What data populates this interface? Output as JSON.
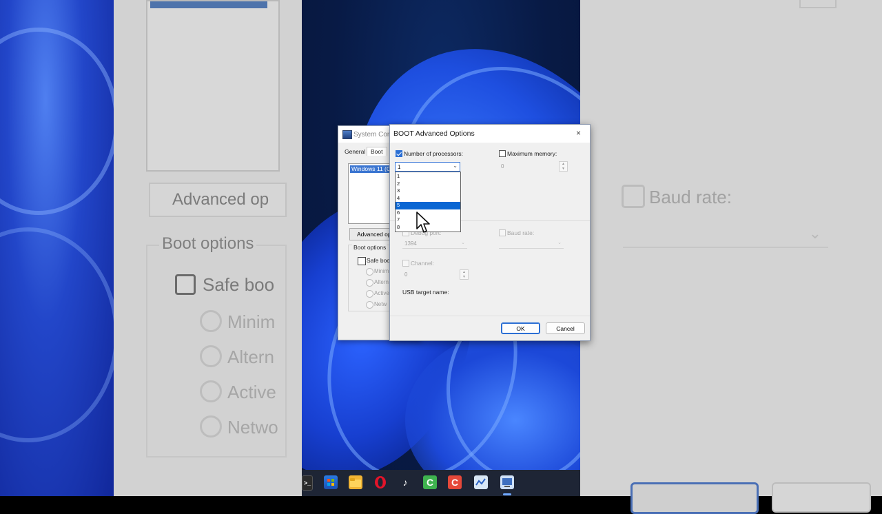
{
  "background_left": {
    "advanced_button": "Advanced op",
    "boot_options_title": "Boot options",
    "safe_boot_label": "Safe boo",
    "radios": [
      "Minim",
      "Altern",
      "Active",
      "Netwo"
    ]
  },
  "background_right": {
    "baud_rate_label": "Baud rate:"
  },
  "system_config": {
    "title": "System Con",
    "tabs": [
      "General",
      "Boot"
    ],
    "boot_entry": "Windows 11 (C",
    "advanced_button": "Advanced op",
    "boot_options_title": "Boot options",
    "safe_boot_label": "Safe boo",
    "radios": [
      "Minim",
      "Altern",
      "Active",
      "Netw"
    ]
  },
  "advanced_options": {
    "title": "BOOT Advanced Options",
    "close_glyph": "×",
    "num_processors_label": "Number of processors:",
    "num_processors_checked": true,
    "num_processors_value": "1",
    "dropdown_options": [
      "1",
      "2",
      "3",
      "4",
      "5",
      "6",
      "7",
      "8"
    ],
    "dropdown_selected_index": 4,
    "max_memory_label": "Maximum memory:",
    "max_memory_checked": false,
    "max_memory_value": "0",
    "debug_port_label": "Debug port:",
    "debug_port_value": "1394",
    "baud_rate_label": "Baud rate:",
    "channel_label": "Channel:",
    "channel_value": "0",
    "usb_target_label": "USB target name:",
    "ok_label": "OK",
    "cancel_label": "Cancel"
  },
  "taskbar": {
    "icons": [
      "terminal-icon",
      "store-icon",
      "file-explorer-icon",
      "opera-icon",
      "tiktok-icon",
      "camtasia-icon",
      "camtasia-recorder-icon",
      "performance-monitor-icon",
      "system-configuration-icon"
    ]
  },
  "colors": {
    "accent": "#0a66d3",
    "taskbar": "#1e2535",
    "dialog_bg": "#f0f0f0"
  }
}
